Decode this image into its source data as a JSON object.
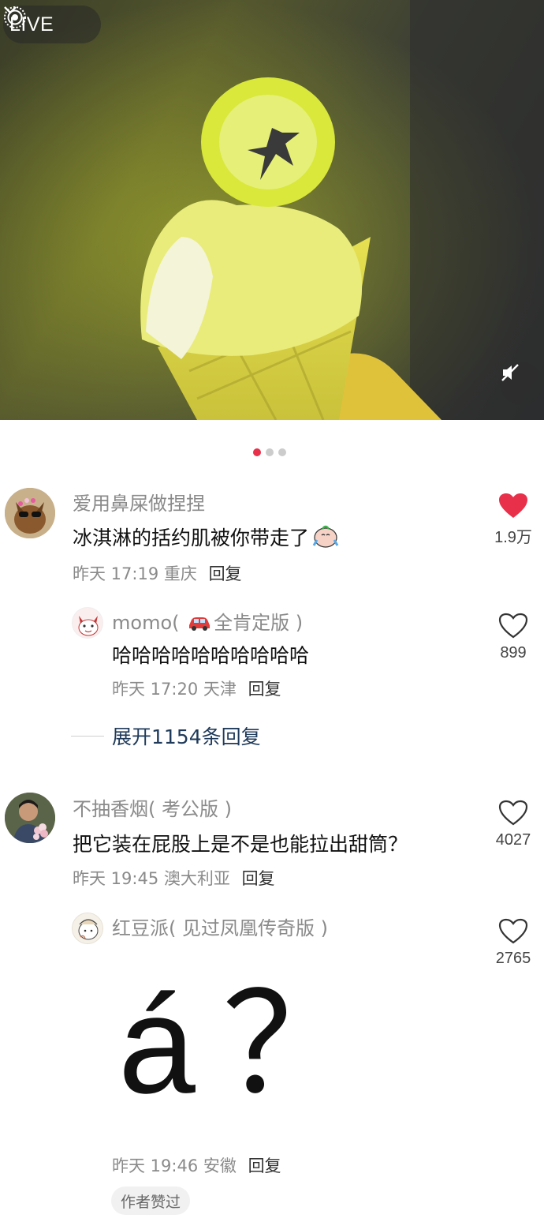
{
  "live_badge": {
    "label": "LIVE"
  },
  "pager": {
    "total": 3,
    "active": 0
  },
  "comments": [
    {
      "username": "爱用鼻屎做捏捏",
      "text": "冰淇淋的括约肌被你带走了",
      "time": "昨天 17:19 重庆",
      "reply_label": "回复",
      "likes": "1.9万",
      "liked": true,
      "avatar_icon": "dog-with-sunglasses-avatar",
      "emoji_icon": "crying-face-emoji"
    },
    {
      "username_prefix": "momo(",
      "username_suffix": "全肯定版 )",
      "username_icon": "red-car-emoji",
      "text": "哈哈哈哈哈哈哈哈哈哈",
      "time": "昨天 17:20 天津",
      "reply_label": "回复",
      "likes": "899",
      "liked": false,
      "avatar_icon": "cartoon-cat-avatar"
    },
    {
      "username": "不抽香烟( 考公版 )",
      "text": "把它装在屁股上是不是也能拉出甜筒？",
      "time": "昨天 19:45 澳大利亚",
      "reply_label": "回复",
      "likes": "4027",
      "liked": false,
      "avatar_icon": "man-with-flowers-avatar"
    },
    {
      "username": "红豆派( 见过凤凰传奇版 )",
      "text": "á？",
      "time": "昨天 19:46 安徽",
      "reply_label": "回复",
      "likes": "2765",
      "liked": false,
      "avatar_icon": "cartoon-drawing-avatar",
      "badge": "作者赞过"
    }
  ],
  "expand_replies": {
    "label": "展开1154条回复"
  },
  "colors": {
    "accent_red": "#e8304a",
    "muted_text": "#8a8a8a",
    "link_dark": "#1f3a5a"
  }
}
